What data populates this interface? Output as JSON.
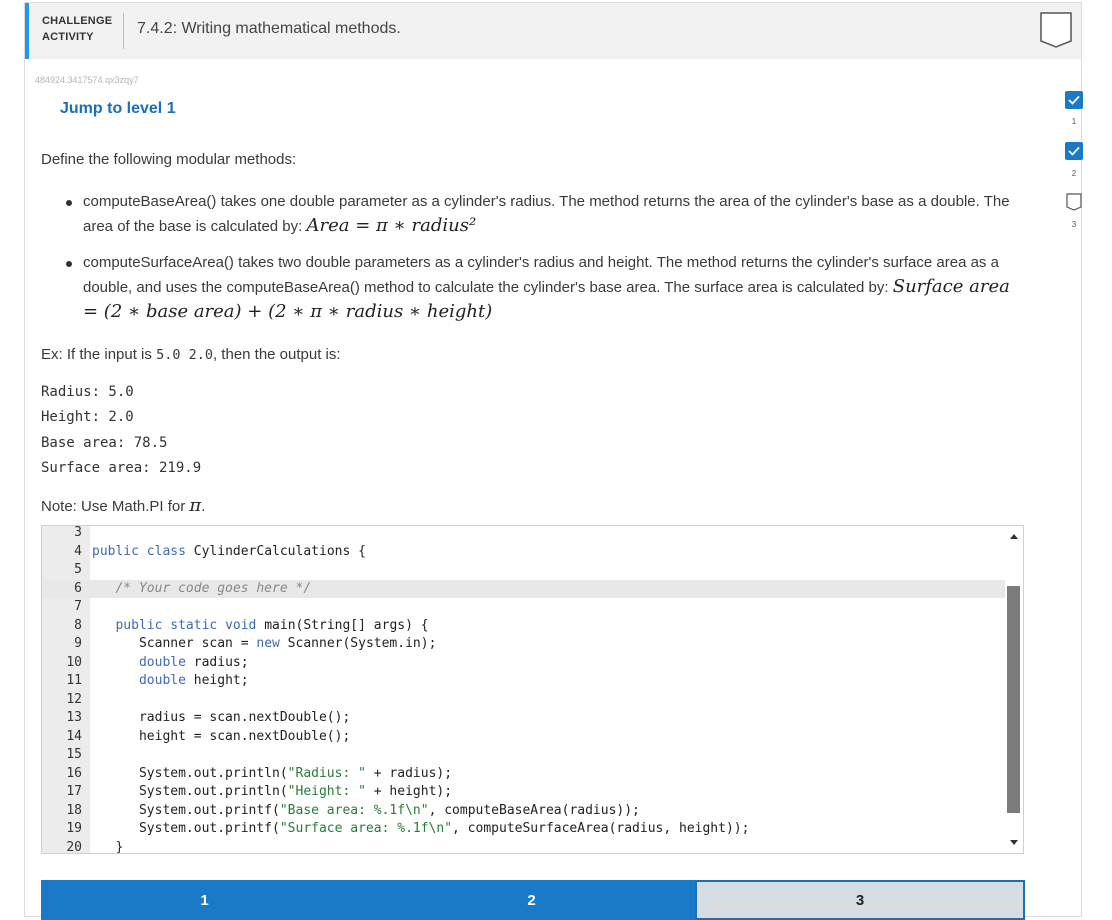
{
  "header": {
    "challenge_line1": "CHALLENGE",
    "challenge_line2": "ACTIVITY",
    "title": "7.4.2: Writing mathematical methods."
  },
  "activity_id": "484924.3417574.qx3zqy7",
  "jump_link": "Jump to level 1",
  "intro": "Define the following modular methods:",
  "bullets": {
    "b1_text": "computeBaseArea() takes one double parameter as a cylinder's radius. The method returns the area of the cylinder's base as a double. The area of the base is calculated by:",
    "b1_formula": "Area = π ∗ radius²",
    "b2_text": "computeSurfaceArea() takes two double parameters as a cylinder's radius and height. The method returns the cylinder's surface area as a double, and uses the computeBaseArea() method to calculate the cylinder's base area. The surface area is calculated by:",
    "b2_formula": "Surface area = (2 ∗ base area) + (2 ∗ π ∗ radius ∗ height)"
  },
  "example": {
    "prefix": "Ex: If the input is ",
    "input": "5.0 2.0",
    "suffix": ", then the output is:"
  },
  "output_lines": [
    "Radius: 5.0",
    "Height: 2.0",
    "Base area: 78.5",
    "Surface area: 219.9"
  ],
  "note": {
    "prefix": "Note: Use Math.PI for ",
    "symbol": "π",
    "suffix": "."
  },
  "code_lines": [
    {
      "n": "3",
      "t": ""
    },
    {
      "n": "4",
      "t": "public class CylinderCalculations {"
    },
    {
      "n": "5",
      "t": ""
    },
    {
      "n": "6",
      "t": "   /* Your code goes here */"
    },
    {
      "n": "7",
      "t": ""
    },
    {
      "n": "8",
      "t": "   public static void main(String[] args) {"
    },
    {
      "n": "9",
      "t": "      Scanner scan = new Scanner(System.in);"
    },
    {
      "n": "10",
      "t": "      double radius;"
    },
    {
      "n": "11",
      "t": "      double height;"
    },
    {
      "n": "12",
      "t": ""
    },
    {
      "n": "13",
      "t": "      radius = scan.nextDouble();"
    },
    {
      "n": "14",
      "t": "      height = scan.nextDouble();"
    },
    {
      "n": "15",
      "t": ""
    },
    {
      "n": "16",
      "t": "      System.out.println(\"Radius: \" + radius);"
    },
    {
      "n": "17",
      "t": "      System.out.println(\"Height: \" + height);"
    },
    {
      "n": "18",
      "t": "      System.out.printf(\"Base area: %.1f\\n\", computeBaseArea(radius));"
    },
    {
      "n": "19",
      "t": "      System.out.printf(\"Surface area: %.1f\\n\", computeSurfaceArea(radius, height));"
    },
    {
      "n": "20",
      "t": "   }"
    }
  ],
  "levels": [
    {
      "label": "1",
      "state": "done"
    },
    {
      "label": "2",
      "state": "done"
    },
    {
      "label": "3",
      "state": "current"
    }
  ],
  "side_levels": [
    "1",
    "2",
    "3"
  ],
  "colors": {
    "accent": "#1a7ac7",
    "link": "#1a6fb5",
    "header_bar": "#2196f3"
  }
}
